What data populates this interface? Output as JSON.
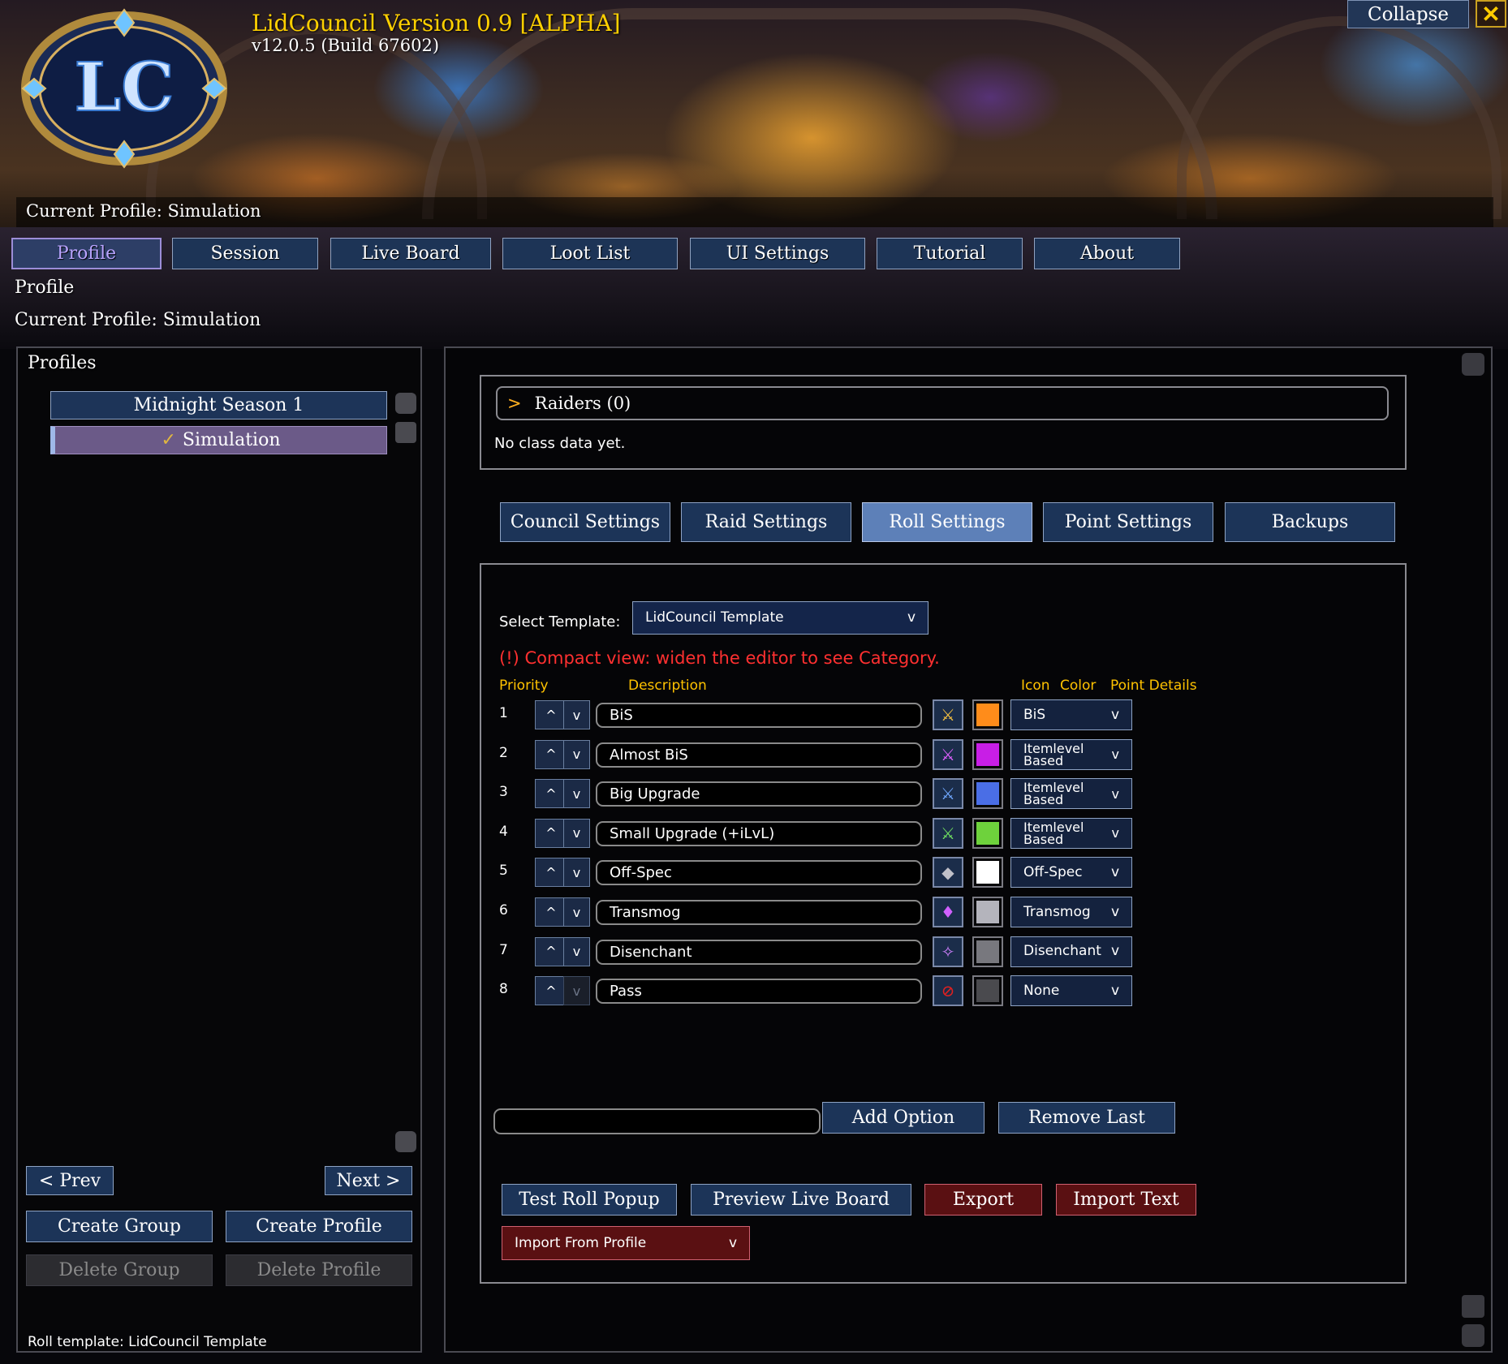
{
  "header": {
    "title": "LidCouncil Version 0.9 [ALPHA]",
    "version": "v12.0.5 (Build 67602)",
    "logo_text": "LC",
    "collapse_label": "Collapse",
    "close_glyph": "✕",
    "current_profile": "Current Profile: Simulation"
  },
  "tabs": [
    "Profile",
    "Session",
    "Live Board",
    "Loot List",
    "UI Settings",
    "Tutorial",
    "About"
  ],
  "active_tab": "Profile",
  "page": {
    "heading": "Profile",
    "current_profile": "Current Profile: Simulation"
  },
  "left_panel": {
    "title": "Profiles",
    "profiles": [
      {
        "label": "Midnight Season 1",
        "selected": false
      },
      {
        "label": "Simulation",
        "selected": true,
        "check": "✓"
      }
    ],
    "prev_label": "< Prev",
    "next_label": "Next >",
    "create_group_label": "Create Group",
    "create_profile_label": "Create Profile",
    "delete_group_label": "Delete Group",
    "delete_profile_label": "Delete Profile",
    "footer": "Roll template: LidCouncil Template"
  },
  "raiders": {
    "toggle": ">",
    "title": "Raiders (0)",
    "empty": "No class data yet."
  },
  "sub_tabs": [
    "Council Settings",
    "Raid Settings",
    "Roll Settings",
    "Point Settings",
    "Backups"
  ],
  "active_sub_tab": "Roll Settings",
  "roll_settings": {
    "select_template_label": "Select Template:",
    "template_value": "LidCouncil Template",
    "dropdown_arrow": "v",
    "warning": "(!) Compact view: widen the editor to see Category.",
    "columns": {
      "priority": "Priority",
      "description": "Description",
      "icon": "Icon",
      "color": "Color",
      "details": "Point Details"
    },
    "up_glyph": "^",
    "down_glyph": "v",
    "rows": [
      {
        "priority": "1",
        "description": "BiS",
        "icon": "bis-icon",
        "color": "#ff8c1a",
        "details": "BiS"
      },
      {
        "priority": "2",
        "description": "Almost BiS",
        "icon": "almost-bis-icon",
        "color": "#c81ee6",
        "details": "Itemlevel Based"
      },
      {
        "priority": "3",
        "description": "Big Upgrade",
        "icon": "big-upgrade-icon",
        "color": "#4a6ee6",
        "details": "Itemlevel Based"
      },
      {
        "priority": "4",
        "description": "Small Upgrade (+iLvL)",
        "icon": "small-upgrade-icon",
        "color": "#6ed23c",
        "details": "Itemlevel Based"
      },
      {
        "priority": "5",
        "description": "Off-Spec",
        "icon": "off-spec-shield-icon",
        "color": "#ffffff",
        "details": "Off-Spec"
      },
      {
        "priority": "6",
        "description": "Transmog",
        "icon": "transmog-armor-icon",
        "color": "#b4b4bc",
        "details": "Transmog"
      },
      {
        "priority": "7",
        "description": "Disenchant",
        "icon": "disenchant-icon",
        "color": "#78787e",
        "details": "Disenchant"
      },
      {
        "priority": "8",
        "description": "Pass",
        "icon": "pass-icon",
        "color": "#4a4a4e",
        "details": "None"
      }
    ],
    "new_option_value": "",
    "add_option_label": "Add Option",
    "remove_last_label": "Remove Last",
    "test_roll_label": "Test Roll Popup",
    "preview_label": "Preview Live Board",
    "export_label": "Export",
    "import_text_label": "Import Text",
    "import_profile_label": "Import From Profile"
  }
}
